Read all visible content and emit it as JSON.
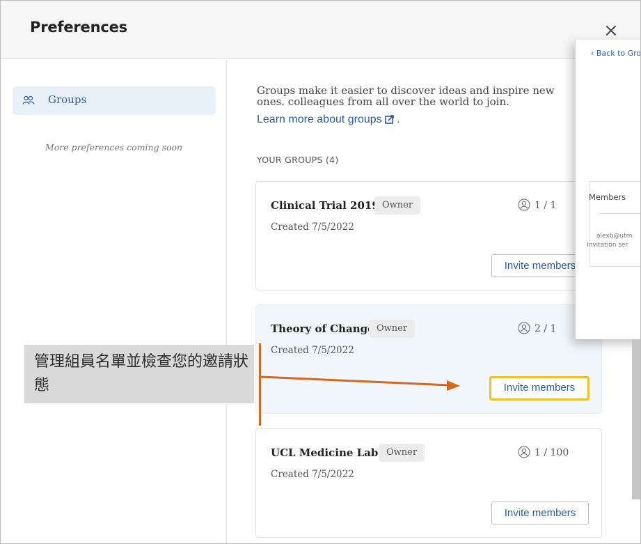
{
  "dialog": {
    "title": "Preferences",
    "close_label": "×"
  },
  "sidebar": {
    "items": [
      {
        "label": "Groups",
        "icon": "groups-icon",
        "active": true
      }
    ],
    "note": "More preferences coming soon"
  },
  "main": {
    "intro": "Groups make it easier to discover ideas and inspire new ones. colleagues from all over the world to join.",
    "learn_more": "Learn more about groups",
    "learn_more_suffix": ".",
    "section_title": "YOUR GROUPS (4)",
    "groups": [
      {
        "name": "Clinical Trial 2019",
        "role": "Owner",
        "created": "Created 7/5/2022",
        "members": "1 / 1",
        "invite_label": "Invite members"
      },
      {
        "name": "Theory of Change",
        "role": "Owner",
        "created": "Created 7/5/2022",
        "members": "2 / 1",
        "invite_label": "Invite members"
      },
      {
        "name": "UCL Medicine Lab",
        "role": "Owner",
        "created": "Created 7/5/2022",
        "members": "1 / 100",
        "invite_label": "Invite members"
      }
    ]
  },
  "side_panel": {
    "back_label": "Back to Gro",
    "members_header": "Members",
    "member_email": "alexb@utm",
    "member_status": "Invitation ser"
  },
  "annotation": {
    "text": "管理組員名單並檢查您的邀請狀態",
    "color": "#d2691e",
    "highlight_color": "#f3c21c"
  },
  "colors": {
    "link": "#2a5da8",
    "active_bg": "#e8f0f8"
  }
}
